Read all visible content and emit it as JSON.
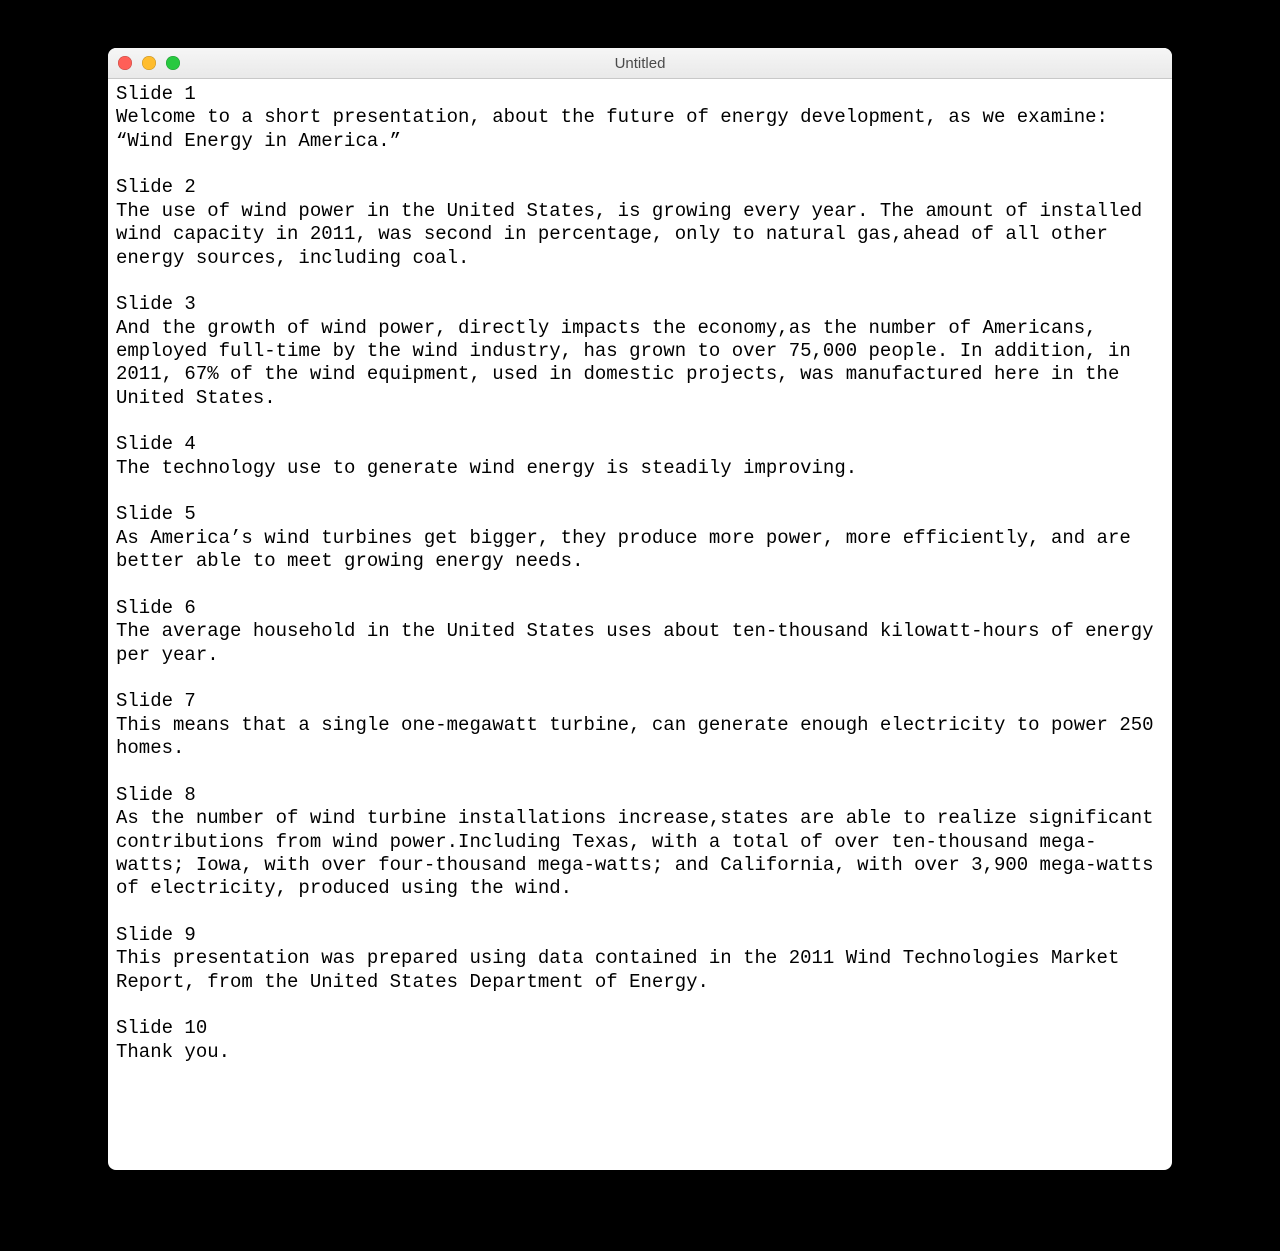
{
  "window": {
    "title": "Untitled"
  },
  "slides": [
    {
      "heading": "Slide 1",
      "body": "Welcome to a short presentation, about the future of energy development, as we examine: “Wind Energy in America.”"
    },
    {
      "heading": "Slide 2",
      "body": "The use of wind power in the United States, is growing every year. The amount of installed wind capacity in 2011, was second in percentage, only to natural gas,ahead of all other energy sources, including coal."
    },
    {
      "heading": "Slide 3",
      "body": "And the growth of wind power, directly impacts the economy,as the number of Americans, employed full-time by the wind industry, has grown to over 75,000 people. In addition, in 2011, 67% of the wind equipment, used in domestic projects, was manufactured here in the United States."
    },
    {
      "heading": "Slide 4",
      "body": "The technology use to generate wind energy is steadily improving."
    },
    {
      "heading": "Slide 5",
      "body": "As America’s wind turbines get bigger, they produce more power, more efficiently, and are better able to meet growing energy needs."
    },
    {
      "heading": "Slide 6",
      "body": "The average household in the United States uses about ten-thousand kilowatt-hours of energy per year."
    },
    {
      "heading": "Slide 7",
      "body": "This means that a single one-megawatt turbine, can generate enough electricity to power 250 homes."
    },
    {
      "heading": "Slide 8",
      "body": "As the number of wind turbine installations increase,states are able to realize significant contributions from wind power.Including Texas, with a total of over ten-thousand mega-watts; Iowa, with over four-thousand mega-watts; and California, with over 3,900 mega-watts of electricity, produced using the wind."
    },
    {
      "heading": "Slide 9",
      "body": "This presentation was prepared using data contained in the 2011 Wind Technologies Market Report, from the United States Department of Energy."
    },
    {
      "heading": "Slide 10",
      "body": "Thank you."
    }
  ]
}
